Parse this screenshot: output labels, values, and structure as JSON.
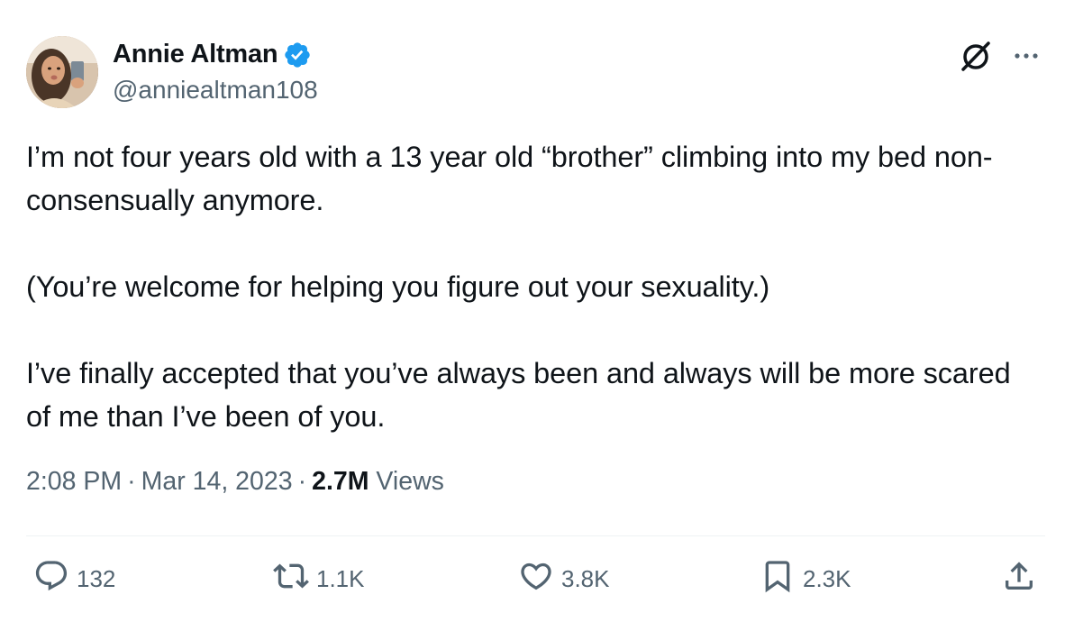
{
  "author": {
    "display_name": "Annie Altman",
    "handle": "@anniealtman108",
    "verified": true,
    "verified_color": "#1d9bf0"
  },
  "tweet": {
    "paragraphs": [
      "I’m not four years old with a 13 year old “brother” climbing into my bed non-consensually anymore.",
      "(You’re welcome for helping you figure out your sexuality.)",
      "I’ve finally accepted that you’ve always been and always will be more scared of me than I’ve been of you."
    ]
  },
  "meta": {
    "time": "2:08 PM",
    "separator": "·",
    "date": "Mar 14, 2023",
    "views_count": "2.7M",
    "views_label": "Views"
  },
  "actions": {
    "reply_count": "132",
    "retweet_count": "1.1K",
    "like_count": "3.8K",
    "bookmark_count": "2.3K"
  },
  "icons": {
    "header_right": [
      "grok-icon",
      "more-icon"
    ],
    "actions": [
      "reply-icon",
      "retweet-icon",
      "like-icon",
      "bookmark-icon",
      "share-icon"
    ]
  },
  "colors": {
    "text_primary": "#0f1419",
    "text_secondary": "#536471",
    "divider": "#eff3f4",
    "verified": "#1d9bf0"
  }
}
